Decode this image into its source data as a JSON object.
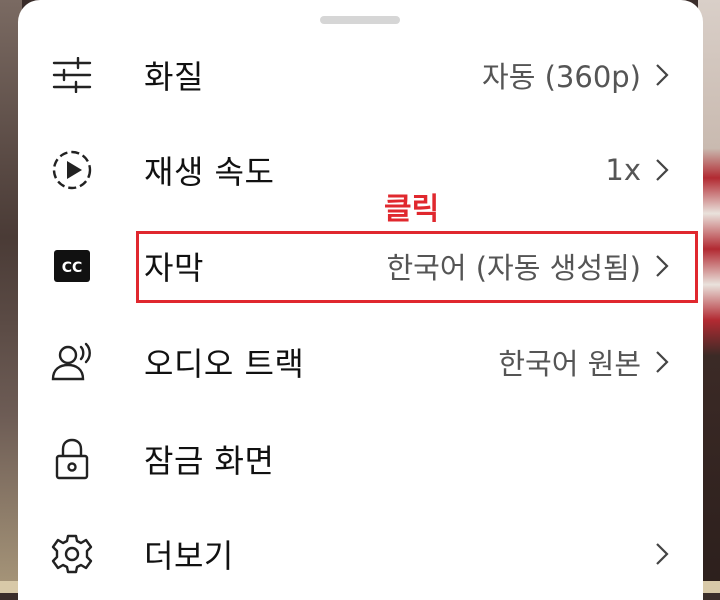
{
  "colors": {
    "sheet": "#ffffff",
    "text": "#111111",
    "value": "#555555",
    "annotation": "#e0282e"
  },
  "menu": {
    "items": [
      {
        "id": "quality",
        "icon": "sliders-icon",
        "label": "화질",
        "value": "자동 (360p)"
      },
      {
        "id": "speed",
        "icon": "playback-speed-icon",
        "label": "재생 속도",
        "value": "1x"
      },
      {
        "id": "captions",
        "icon": "closed-captions-icon",
        "label": "자막",
        "value": "한국어 (자동 생성됨)"
      },
      {
        "id": "audio",
        "icon": "audio-track-icon",
        "label": "오디오 트랙",
        "value": "한국어 원본"
      },
      {
        "id": "lock",
        "icon": "lock-icon",
        "label": "잠금 화면",
        "value": ""
      },
      {
        "id": "more",
        "icon": "gear-icon",
        "label": "더보기",
        "value": ""
      }
    ]
  },
  "annotation": {
    "label": "클릭"
  }
}
